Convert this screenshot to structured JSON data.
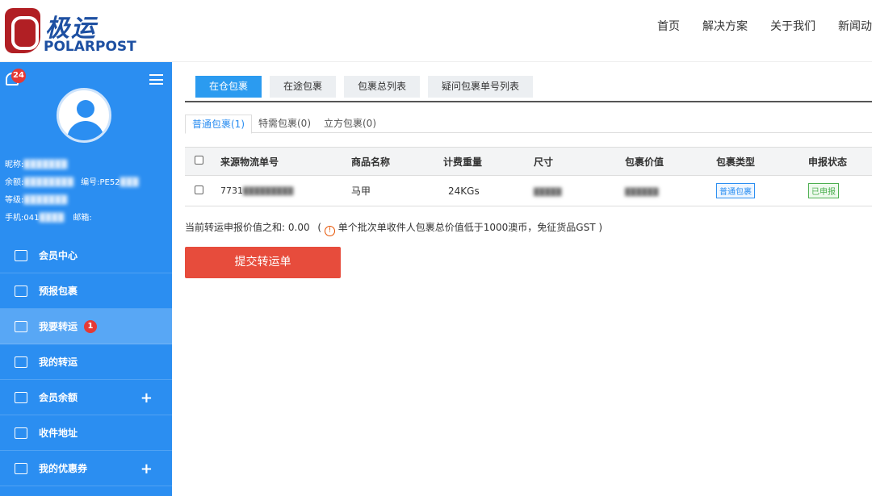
{
  "header": {
    "logo_cn": "极运",
    "logo_en": "POLARPOST",
    "nav": [
      "首页",
      "解决方案",
      "关于我们",
      "新闻动"
    ]
  },
  "sidebar": {
    "notification_count": "24",
    "profile": {
      "nickname_label": "昵称:",
      "nickname_value": "███████",
      "balance_label": "余额:",
      "balance_value": "████████",
      "code_label": "编号:",
      "code_value": "PE52",
      "level_label": "等级:",
      "level_value": "███████",
      "phone_label": "手机:",
      "phone_value": "041",
      "email_label": "邮箱:"
    },
    "menu": [
      {
        "label": "会员中心",
        "icon": "chart-icon"
      },
      {
        "label": "预报包裹",
        "icon": "form-icon"
      },
      {
        "label": "我要转运",
        "icon": "box-icon",
        "badge": "1"
      },
      {
        "label": "我的转运",
        "icon": "truck-icon"
      },
      {
        "label": "会员余额",
        "icon": "edit-icon",
        "expand": "+"
      },
      {
        "label": "收件地址",
        "icon": "address-icon"
      },
      {
        "label": "我的优惠券",
        "icon": "coupon-icon",
        "expand": "+"
      }
    ]
  },
  "main": {
    "tabs": [
      "在仓包裹",
      "在途包裹",
      "包裹总列表",
      "疑问包裹单号列表"
    ],
    "subtabs": [
      "普通包裹(1)",
      "特需包裹(0)",
      "立方包裹(0)"
    ],
    "table": {
      "headers": [
        "来源物流单号",
        "商品名称",
        "计费重量",
        "尺寸",
        "包裹价值",
        "包裹类型",
        "申报状态"
      ],
      "rows": [
        {
          "tracking": "7731",
          "tracking_hidden": "█████████",
          "product": "马甲",
          "weight": "24KGs",
          "size": "█████",
          "value": "██████",
          "type": "普通包裹",
          "status": "已申报"
        }
      ]
    },
    "sum_label": "当前转运申报价值之和:",
    "sum_value": "0.00",
    "notice": "单个批次单收件人包裹总价值低于1000澳币，免征货品GST",
    "submit": "提交转运单"
  },
  "colors": {
    "sidebar": "#2b8ef1",
    "active_tab": "#2b9bf0",
    "submit": "#e74c3c",
    "badge": "#e53935"
  }
}
